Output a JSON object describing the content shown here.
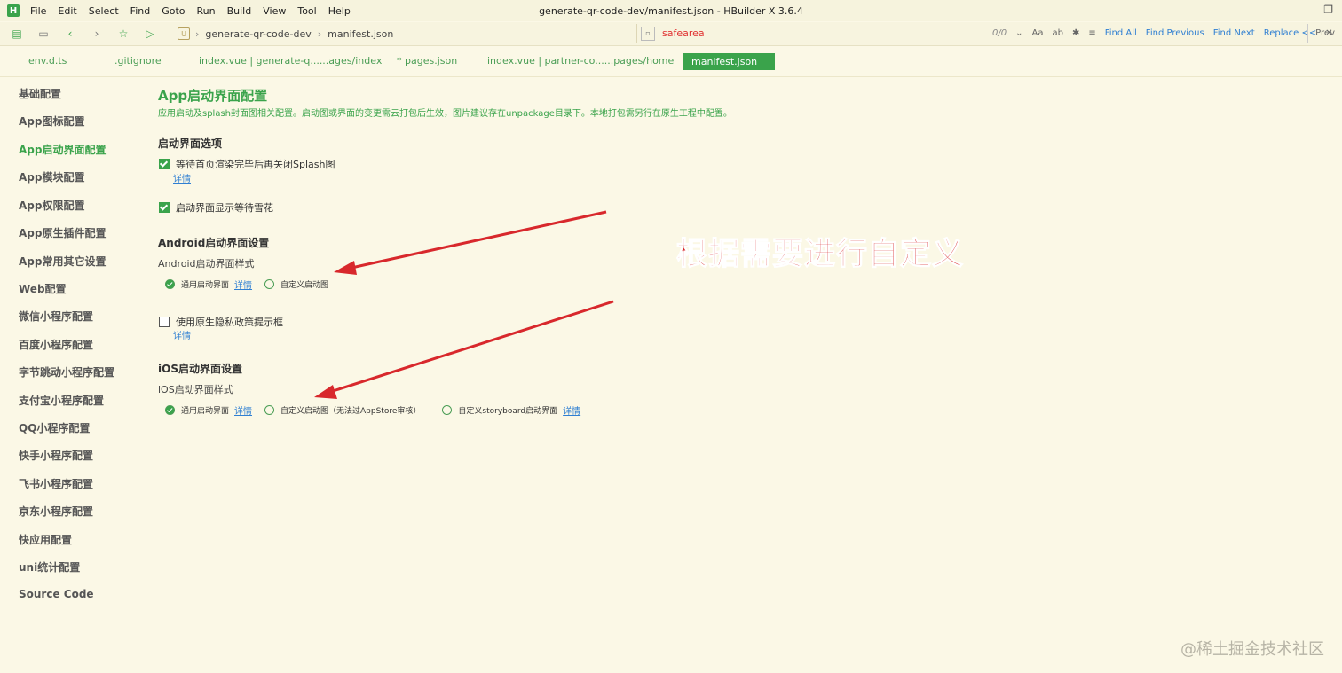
{
  "menu": {
    "items": [
      "File",
      "Edit",
      "Select",
      "Find",
      "Goto",
      "Run",
      "Build",
      "View",
      "Tool",
      "Help"
    ],
    "window_title": "generate-qr-code-dev/manifest.json - HBuilder X 3.6.4"
  },
  "toolbar": {
    "project": "generate-qr-code-dev",
    "file": "manifest.json",
    "search_value": "safearea",
    "match_count": "0/0",
    "find_all": "Find All",
    "find_previous": "Find Previous",
    "find_next": "Find Next",
    "replace": "Replace <<",
    "preview": "Prev"
  },
  "tabs": [
    {
      "label": "env.d.ts"
    },
    {
      "label": ".gitignore"
    },
    {
      "label": "index.vue | generate-q......ages/index"
    },
    {
      "label": "* pages.json"
    },
    {
      "label": "index.vue | partner-co......pages/home"
    },
    {
      "label": "manifest.json",
      "active": true
    }
  ],
  "sidebar": {
    "items": [
      "基础配置",
      "App图标配置",
      "App启动界面配置",
      "App模块配置",
      "App权限配置",
      "App原生插件配置",
      "App常用其它设置",
      "Web配置",
      "微信小程序配置",
      "百度小程序配置",
      "字节跳动小程序配置",
      "支付宝小程序配置",
      "QQ小程序配置",
      "快手小程序配置",
      "飞书小程序配置",
      "京东小程序配置",
      "快应用配置",
      "uni统计配置",
      "Source Code"
    ],
    "active_index": 2
  },
  "main": {
    "title": "App启动界面配置",
    "desc": "应用启动及splash封面图相关配置。启动图或界面的变更需云打包后生效，图片建议存在unpackage目录下。本地打包需另行在原生工程中配置。",
    "splash_section": "启动界面选项",
    "opt_wait": "等待首页渲染完毕后再关闭Splash图",
    "detail": "详情",
    "opt_snow": "启动界面显示等待雪花",
    "android_section": "Android启动界面设置",
    "android_style": "Android启动界面样式",
    "radio_common": "通用启动界面",
    "radio_custom": "自定义启动图",
    "privacy": "使用原生隐私政策提示框",
    "ios_section": "iOS启动界面设置",
    "ios_style": "iOS启动界面样式",
    "ios_custom": "自定义启动图（无法过AppStore审核）",
    "ios_storyboard": "自定义storyboard启动界面"
  },
  "annotation": "根据需要进行自定义",
  "watermark": "@稀土掘金技术社区",
  "colors": {
    "accent": "#3aa34b",
    "background": "#fbf8e6",
    "annotation": "#d8282c",
    "link": "#2f7fd2"
  }
}
